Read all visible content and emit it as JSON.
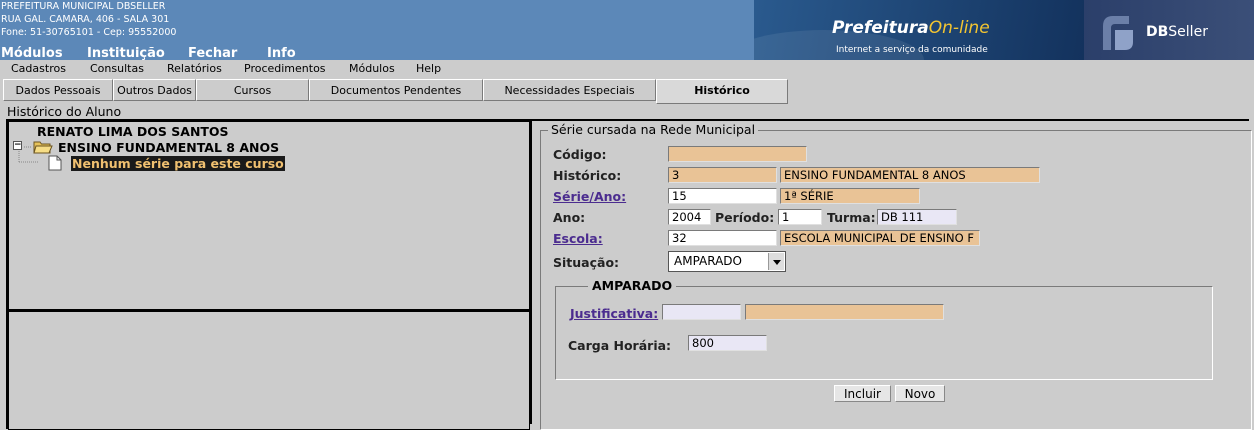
{
  "header": {
    "org_line1": "PREFEITURA MUNICIPAL DBSELLER",
    "org_line2": "RUA GAL. CAMARA, 406 - SALA 301",
    "org_line3": "Fone: 51-30765101  -  Cep: 95552000",
    "brand_main": "Prefeitura",
    "brand_online": "On-line",
    "tagline": "Internet a serviço da comunidade",
    "db_logo_bold": "DB",
    "db_logo_rest": "Seller",
    "top_menu": [
      "Módulos",
      "Instituição",
      "Fechar",
      "Info"
    ]
  },
  "menubar": [
    "Cadastros",
    "Consultas",
    "Relatórios",
    "Procedimentos",
    "Módulos",
    "Help"
  ],
  "tabs": [
    "Dados Pessoais",
    "Outros Dados",
    "Cursos",
    "Documentos Pendentes",
    "Necessidades Especiais",
    "Histórico"
  ],
  "section_title": "Histórico do Aluno",
  "tree": {
    "student": "RENATO LIMA DOS SANTOS",
    "course": "ENSINO FUNDAMENTAL 8 ANOS",
    "empty_item": "Nenhum série para este curso",
    "expander": "−"
  },
  "form": {
    "legend": "Série cursada na Rede Municipal",
    "codigo_label": "Código:",
    "codigo_value": "",
    "historico_label": "Histórico:",
    "historico_code": "3",
    "historico_desc": "ENSINO FUNDAMENTAL 8 ANOS",
    "serie_label": "Série/Ano:",
    "serie_code": "15",
    "serie_desc": "1ª SÉRIE",
    "ano_label": "Ano:",
    "ano_value": "2004",
    "periodo_label": "Período:",
    "periodo_value": "1",
    "turma_label": "Turma:",
    "turma_value": "DB 111",
    "escola_label": "Escola:",
    "escola_code": "32",
    "escola_desc": "ESCOLA MUNICIPAL DE ENSINO F",
    "situacao_label": "Situação:",
    "situacao_value": "AMPARADO",
    "amparado_legend": "AMPARADO",
    "justificativa_label": "Justificativa:",
    "justificativa_code": "",
    "justificativa_desc": "",
    "carga_label": "Carga Horária:",
    "carga_value": "800",
    "incluir_label": "Incluir",
    "novo_label": "Novo"
  },
  "colors": {
    "header_bg": "#5c88b8",
    "readonly_field": "#e9c396",
    "lavender_field": "#e9e7f5",
    "link": "#4b2c8f",
    "highlight_bg": "#1a1a1a",
    "highlight_text": "#f0c070"
  }
}
